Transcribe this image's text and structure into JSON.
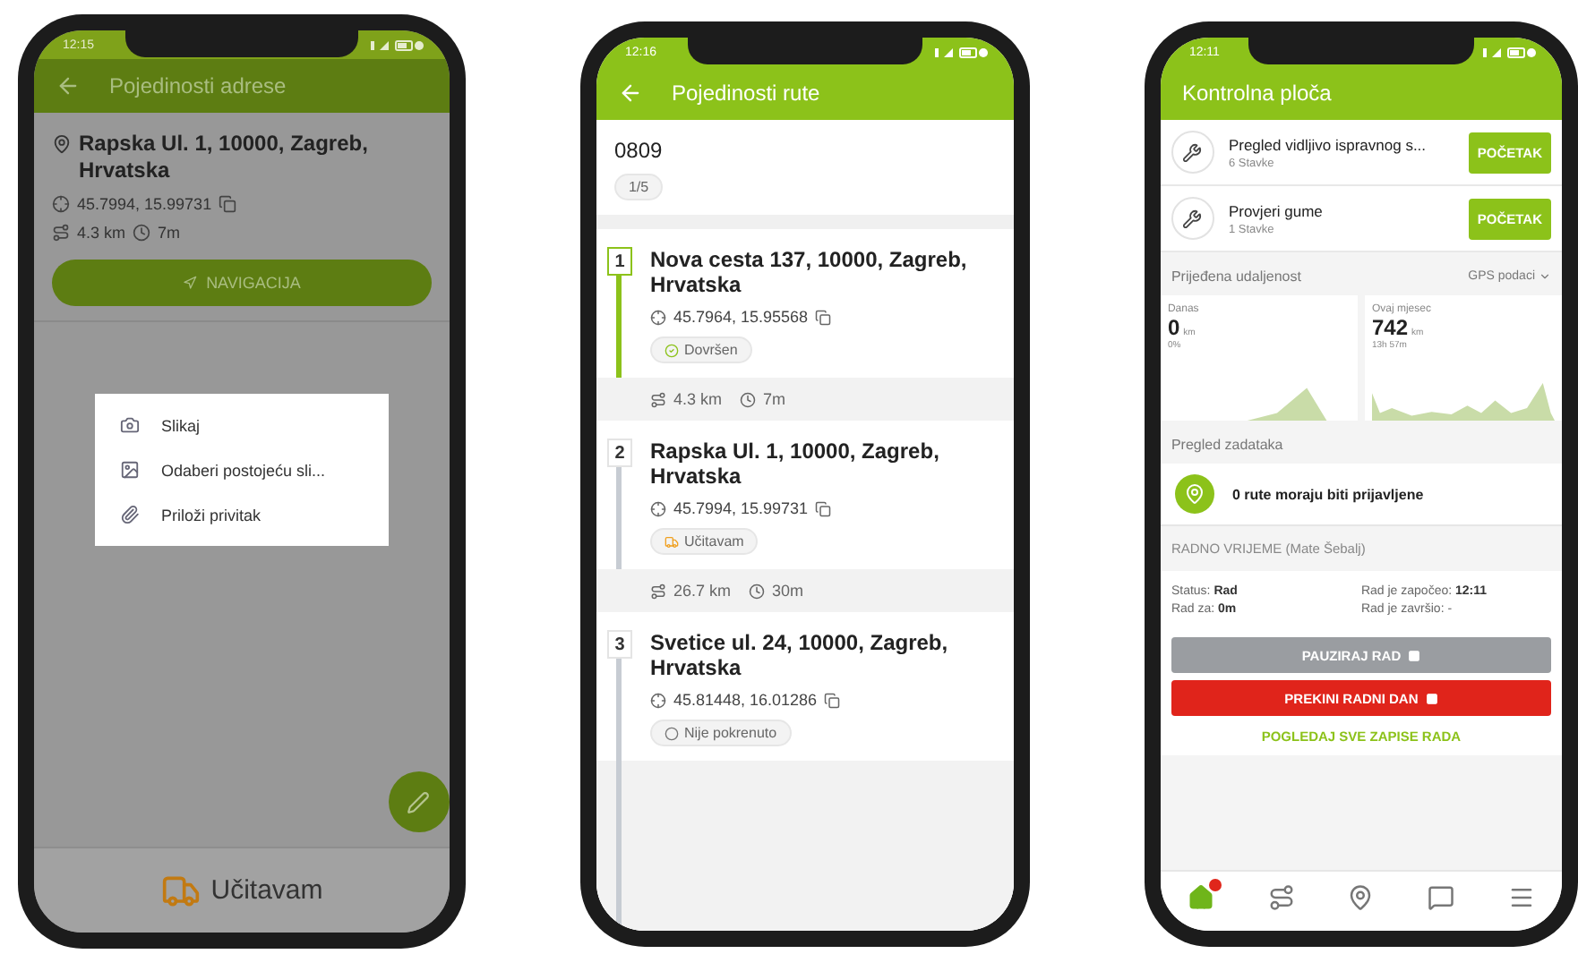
{
  "address_screen": {
    "status_time": "12:15",
    "title": "Pojedinosti adrese",
    "address": "Rapska Ul. 1, 10000, Zagreb, Hrvatska",
    "coords": "45.7994, 15.99731",
    "distance": "4.3 km",
    "duration": "7m",
    "nav_button": "NAVIGACIJA",
    "dialog": [
      {
        "kind": "camera",
        "label": "Slikaj"
      },
      {
        "kind": "gallery",
        "label": "Odaberi postojeću sli..."
      },
      {
        "kind": "attachment",
        "label": "Priloži privitak"
      }
    ],
    "loading": "Učitavam"
  },
  "route_screen": {
    "status_time": "12:16",
    "title": "Pojedinosti rute",
    "route_number": "0809",
    "progress": "1/5",
    "stops": [
      {
        "number": "1",
        "address": "Nova cesta 137, 10000, Zagreb, Hrvatska",
        "coords": "45.7964, 15.95568",
        "status": {
          "kind": "done",
          "label": "Dovršen"
        },
        "leg": {
          "distance": "4.3 km",
          "duration": "7m"
        }
      },
      {
        "number": "2",
        "address": "Rapska Ul. 1, 10000, Zagreb, Hrvatska",
        "coords": "45.7994, 15.99731",
        "status": {
          "kind": "loading",
          "label": "Učitavam"
        },
        "leg": {
          "distance": "26.7 km",
          "duration": "30m"
        }
      },
      {
        "number": "3",
        "address": "Svetice ul. 24, 10000, Zagreb, Hrvatska",
        "coords": "45.81448, 16.01286",
        "status": {
          "kind": "not_started",
          "label": "Nije pokrenuto"
        }
      }
    ]
  },
  "dashboard_screen": {
    "status_time": "12:11",
    "title": "Kontrolna ploča",
    "checklists": [
      {
        "title": "Pregled vidljivo ispravnog s...",
        "count": "6 Stavke",
        "button": "POČETAK"
      },
      {
        "title": "Provjeri gume",
        "count": "1 Stavke",
        "button": "POČETAK"
      }
    ],
    "distance": {
      "title": "Prijeđena udaljenost",
      "filter": "GPS podaci",
      "cards": [
        {
          "label": "Danas",
          "value": "0",
          "unit": "km",
          "sub": "0%"
        },
        {
          "label": "Ovaj mjesec",
          "value": "742",
          "unit": "km",
          "sub": "13h 57m"
        }
      ]
    },
    "tasks": {
      "title": "Pregled zadataka",
      "message": "0 rute moraju biti prijavljene"
    },
    "work": {
      "title": "RADNO VRIJEME (Mate Šebalj)",
      "status_label": "Status:",
      "status_value": "Rad",
      "started_label": "Rad je započeo:",
      "started_value": "12:11",
      "duration_label": "Rad za:",
      "duration_value": "0m",
      "ended_label": "Rad je završio:",
      "ended_value": "-"
    },
    "buttons": [
      {
        "kind": "pause",
        "label": "PAUZIRAJ RAD"
      },
      {
        "kind": "stop",
        "label": "PREKINI RADNI DAN"
      }
    ],
    "link": "POGLEDAJ SVE ZAPISE RADA",
    "nav": [
      {
        "selected": true,
        "badge": true
      },
      {
        "selected": false,
        "badge": false
      },
      {
        "selected": false,
        "badge": false
      },
      {
        "selected": false,
        "badge": false
      },
      {
        "selected": false,
        "badge": false
      }
    ]
  }
}
